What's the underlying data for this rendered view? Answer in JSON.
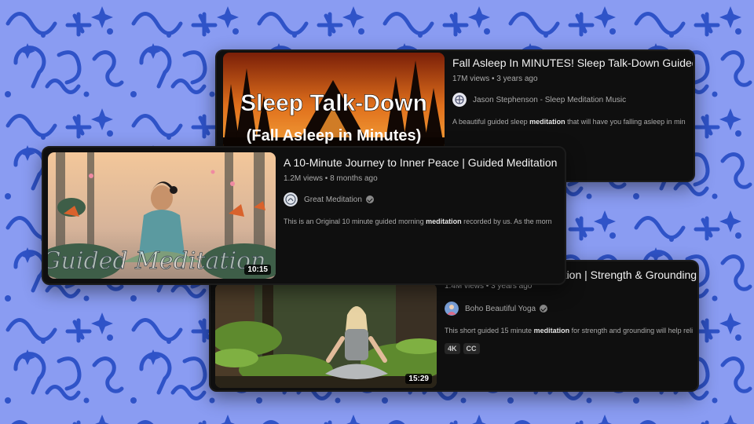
{
  "colors": {
    "background": "#8a9cf2",
    "pattern": "#2f53c8",
    "card": "#0f0f0f"
  },
  "videos": [
    {
      "thumbnail_line1": "Sleep Talk-Down",
      "thumbnail_line2": "(Fall Asleep in Minutes)",
      "title": "Fall Asleep In MINUTES! Sleep Talk-Down Guided",
      "views": "17M views • 3 years ago",
      "channel": "Jason Stephenson - Sleep Meditation Music",
      "desc_before": "A beautiful guided sleep ",
      "desc_keyword": "meditation",
      "desc_after": " that will have you falling asleep in min"
    },
    {
      "thumbnail_text": "Guided Meditation",
      "duration": "10:15",
      "title": "A 10-Minute Journey to Inner Peace | Guided Meditation",
      "views": "1.2M views • 8 months ago",
      "channel": "Great Meditation",
      "desc_before": "This is an Original 10 minute guided morning ",
      "desc_keyword": "meditation",
      "desc_after": " recorded by us. As the morn"
    },
    {
      "duration": "15:29",
      "title_visible": "tation | Strength & Grounding",
      "views": "1.4M views • 3 years ago",
      "channel": "Boho Beautiful Yoga",
      "desc_before": "This short guided 15 minute ",
      "desc_keyword": "meditation",
      "desc_after": " for strength and grounding will help reli",
      "badges": [
        "4K",
        "CC"
      ],
      "avatar_icon": "yoga-avatar-icon"
    }
  ]
}
